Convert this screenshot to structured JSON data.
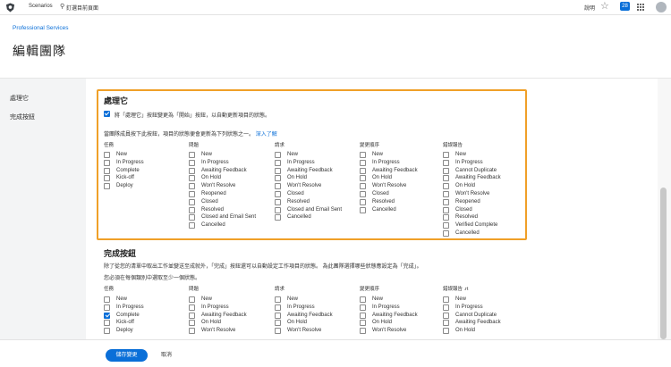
{
  "topbar": {
    "scenarios": "Scenarios",
    "pin_page": "釘選目前頁面",
    "help": "說明",
    "notification_count": "28",
    "logo_icon": "shield-logo-icon",
    "pin_icon": "pin-icon",
    "star_icon": "star-icon",
    "grid_icon": "grid-menu-icon"
  },
  "breadcrumb": "Professional Services",
  "page_title": "編輯團隊",
  "leftnav": {
    "items": [
      {
        "label": "處理它"
      },
      {
        "label": "完成按鈕"
      }
    ]
  },
  "section1": {
    "title": "處理它",
    "checkbox_label": "將「處理它」按鈕變更為「開始」按鈕，以自動更新項目的狀態。",
    "checkbox_checked": true,
    "description": "當團隊成員按下此按鈕，項目的狀態便會更新為下列狀態之一。",
    "learn_more": "深入了解",
    "columns": [
      {
        "header": "任務",
        "options": [
          {
            "label": "New",
            "checked": false
          },
          {
            "label": "In Progress",
            "checked": false
          },
          {
            "label": "Complete",
            "checked": false
          },
          {
            "label": "Kick-off",
            "checked": false
          },
          {
            "label": "Deploy",
            "checked": false
          }
        ]
      },
      {
        "header": "問題",
        "options": [
          {
            "label": "New",
            "checked": false
          },
          {
            "label": "In Progress",
            "checked": false
          },
          {
            "label": "Awaiting Feedback",
            "checked": false
          },
          {
            "label": "On Hold",
            "checked": false
          },
          {
            "label": "Won't Resolve",
            "checked": false
          },
          {
            "label": "Reopened",
            "checked": false
          },
          {
            "label": "Closed",
            "checked": false
          },
          {
            "label": "Resolved",
            "checked": false
          },
          {
            "label": "Closed and Email Sent",
            "checked": false
          },
          {
            "label": "Cancelled",
            "checked": false
          }
        ]
      },
      {
        "header": "請求",
        "options": [
          {
            "label": "New",
            "checked": false
          },
          {
            "label": "In Progress",
            "checked": false
          },
          {
            "label": "Awaiting Feedback",
            "checked": false
          },
          {
            "label": "On Hold",
            "checked": false
          },
          {
            "label": "Won't Resolve",
            "checked": false
          },
          {
            "label": "Closed",
            "checked": false
          },
          {
            "label": "Resolved",
            "checked": false
          },
          {
            "label": "Closed and Email Sent",
            "checked": false
          },
          {
            "label": "Cancelled",
            "checked": false
          }
        ]
      },
      {
        "header": "變更順序",
        "options": [
          {
            "label": "New",
            "checked": false
          },
          {
            "label": "In Progress",
            "checked": false
          },
          {
            "label": "Awaiting Feedback",
            "checked": false
          },
          {
            "label": "On Hold",
            "checked": false
          },
          {
            "label": "Won't Resolve",
            "checked": false
          },
          {
            "label": "Closed",
            "checked": false
          },
          {
            "label": "Resolved",
            "checked": false
          },
          {
            "label": "Cancelled",
            "checked": false
          }
        ]
      },
      {
        "header": "錯誤報告",
        "options": [
          {
            "label": "New",
            "checked": false
          },
          {
            "label": "In Progress",
            "checked": false
          },
          {
            "label": "Cannot Duplicate",
            "checked": false
          },
          {
            "label": "Awaiting Feedback",
            "checked": false
          },
          {
            "label": "On Hold",
            "checked": false
          },
          {
            "label": "Won't Resolve",
            "checked": false
          },
          {
            "label": "Reopened",
            "checked": false
          },
          {
            "label": "Closed",
            "checked": false
          },
          {
            "label": "Resolved",
            "checked": false
          },
          {
            "label": "Verified Complete",
            "checked": false
          },
          {
            "label": "Cancelled",
            "checked": false
          }
        ]
      }
    ]
  },
  "section2": {
    "title": "完成按鈕",
    "description": "除了從您的清單中取出工作並變送至成就外，「完成」按鈕還可以自動設定工作項目的狀態。 為此團隊選擇哪些狀態應設定為「完成」。",
    "note": "您必須在每個類別中選取至少一個狀態。",
    "columns": [
      {
        "header": "任務",
        "options": [
          {
            "label": "New",
            "checked": false
          },
          {
            "label": "In Progress",
            "checked": false
          },
          {
            "label": "Complete",
            "checked": true
          },
          {
            "label": "Kick-off",
            "checked": false
          },
          {
            "label": "Deploy",
            "checked": false
          }
        ]
      },
      {
        "header": "問題",
        "options": [
          {
            "label": "New",
            "checked": false
          },
          {
            "label": "In Progress",
            "checked": false
          },
          {
            "label": "Awaiting Feedback",
            "checked": false
          },
          {
            "label": "On Hold",
            "checked": false
          },
          {
            "label": "Won't Resolve",
            "checked": false
          }
        ]
      },
      {
        "header": "請求",
        "options": [
          {
            "label": "New",
            "checked": false
          },
          {
            "label": "In Progress",
            "checked": false
          },
          {
            "label": "Awaiting Feedback",
            "checked": false
          },
          {
            "label": "On Hold",
            "checked": false
          },
          {
            "label": "Won't Resolve",
            "checked": false
          }
        ]
      },
      {
        "header": "變更順序",
        "options": [
          {
            "label": "New",
            "checked": false
          },
          {
            "label": "In Progress",
            "checked": false
          },
          {
            "label": "Awaiting Feedback",
            "checked": false
          },
          {
            "label": "On Hold",
            "checked": false
          },
          {
            "label": "Won't Resolve",
            "checked": false
          }
        ]
      },
      {
        "header": "錯誤報告 .rt",
        "options": [
          {
            "label": "New",
            "checked": false
          },
          {
            "label": "In Progress",
            "checked": false
          },
          {
            "label": "Cannot Duplicate",
            "checked": false
          },
          {
            "label": "Awaiting Feedback",
            "checked": false
          },
          {
            "label": "On Hold",
            "checked": false
          }
        ]
      }
    ]
  },
  "footer": {
    "save": "儲存變更",
    "cancel": "取消"
  },
  "colors": {
    "accent": "#0a6fd8",
    "highlight_border": "#f0a028"
  }
}
